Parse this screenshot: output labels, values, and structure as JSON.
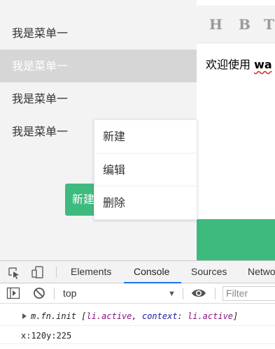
{
  "sidebar": {
    "items": [
      {
        "label": "我是菜单一"
      },
      {
        "label": "我是菜单一"
      },
      {
        "label": "我是菜单一"
      },
      {
        "label": "我是菜单一"
      }
    ],
    "action_button_label": "新建"
  },
  "context_menu": {
    "items": [
      {
        "label": "新建"
      },
      {
        "label": "编辑"
      },
      {
        "label": "删除"
      }
    ]
  },
  "editor": {
    "toolbar": {
      "heading": "H",
      "bold": "B",
      "text": "T"
    },
    "content_prefix": "欢迎使用 ",
    "content_bold": "wa"
  },
  "devtools": {
    "tabs": [
      {
        "label": "Elements"
      },
      {
        "label": "Console",
        "active": true
      },
      {
        "label": "Sources"
      },
      {
        "label": "Netwo"
      }
    ],
    "context": "top",
    "filter_placeholder": "Filter",
    "console": {
      "log1": {
        "prefix": "m.fn.init [",
        "item1": "li.active",
        "middle": ", ",
        "key": "context",
        "colon": ": ",
        "item2": "li.active",
        "suffix": "]"
      },
      "log2": "x:120y:225"
    }
  },
  "colors": {
    "accent_green": "#3fba7f",
    "active_menu_bg": "#d6d6d6",
    "devtools_active_tab": "#1a73e8"
  }
}
